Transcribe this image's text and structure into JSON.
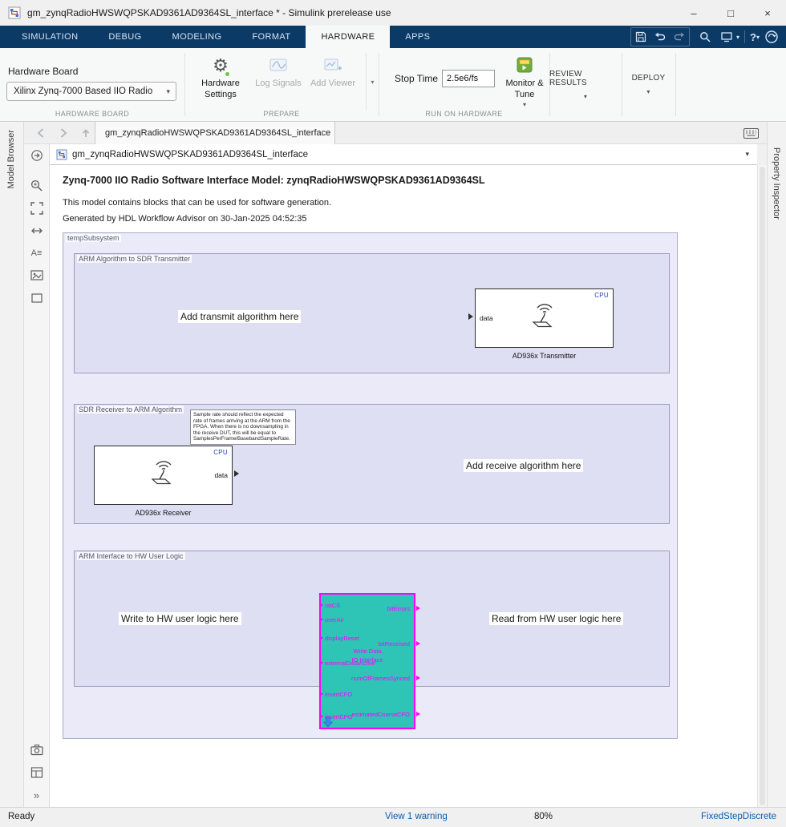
{
  "titlebar": {
    "title": "gm_zynqRadioHWSWQPSKAD9361AD9364SL_interface * - Simulink prerelease use"
  },
  "icons": {
    "minimize": "–",
    "maximize": "□",
    "close": "×",
    "caret_down": "▾",
    "gear": "⚙",
    "help": "?",
    "expand": "»",
    "annotation": "A≡"
  },
  "ribbon_tabs": [
    "SIMULATION",
    "DEBUG",
    "MODELING",
    "FORMAT",
    "HARDWARE",
    "APPS"
  ],
  "toolstrip": {
    "hardware_board_label": "Hardware Board",
    "hardware_board_value": "Xilinx Zynq-7000 Based IIO Radio",
    "section_hardware_board": "HARDWARE BOARD",
    "btn_hardware_settings": "Hardware Settings",
    "btn_log_signals": "Log Signals",
    "btn_add_viewer": "Add Viewer",
    "section_prepare": "PREPARE",
    "stop_time_label": "Stop Time",
    "stop_time_value": "2.5e6/fs",
    "btn_monitor_tune": "Monitor & Tune",
    "section_run": "RUN ON HARDWARE",
    "btn_review_results": "REVIEW RESULTS",
    "btn_deploy": "DEPLOY"
  },
  "navbar": {
    "document_tab": "gm_zynqRadioHWSWQPSKAD9361AD9364SL_interface"
  },
  "breadcrumb": {
    "model_name": "gm_zynqRadioHWSWQPSKAD9361AD9364SL_interface"
  },
  "side_panels": {
    "left": "Model Browser",
    "right": "Property Inspector"
  },
  "canvas": {
    "heading": "Zynq-7000 IIO Radio Software Interface Model: zynqRadioHWSWQPSKAD9361AD9364SL",
    "line1": "This model contains blocks that can be used for software generation.",
    "line2": "Generated by HDL Workflow Advisor on 30-Jan-2025 04:52:35",
    "subsystem_label": "tempSubsystem",
    "tx_area": {
      "label": "ARM Algorithm to SDR Transmitter",
      "note": "Add transmit algorithm here",
      "block_name": "AD936x Transmitter",
      "cpu_tag": "CPU",
      "port": "data"
    },
    "rx_area": {
      "label": "SDR Receiver to ARM Algorithm",
      "annotation": "Sample rate should reflect the expected rate of frames arriving at the ARM from the FPGA. When there is no downsampling in the receive DUT, this will be equal to SamplesPerFrame/BasebandSampleRate.",
      "note": "Add receive algorithm here",
      "block_name": "AD936x Receiver",
      "cpu_tag": "CPU",
      "port": "data"
    },
    "hw_area": {
      "label": "ARM Interface to HW User Logic",
      "note_left": "Write to HW user logic here",
      "note_right": "Read from HW user logic here",
      "block": {
        "title_line1": "Write Data",
        "title_line2": "IO Interface",
        "inputs": [
          "ratCS",
          "overAir",
          "displayReset",
          "externalDataActive",
          "insertCFO",
          "insertCPO"
        ],
        "outputs": [
          "bitErrors",
          "bitReceived",
          "numOfFramesSynced",
          "estimatedCoarseCFO"
        ]
      }
    }
  },
  "statusbar": {
    "ready": "Ready",
    "warning": "View 1 warning",
    "zoom": "80%",
    "solver": "FixedStepDiscrete"
  },
  "colors": {
    "ribbon_navy": "#0b3a67",
    "block_teal": "#2ec4b6",
    "port_magenta": "#ff00ff",
    "link_blue": "#0b5cad",
    "area_fill_outer": "#eaeaf9",
    "area_fill_inner": "#dfdff4"
  }
}
